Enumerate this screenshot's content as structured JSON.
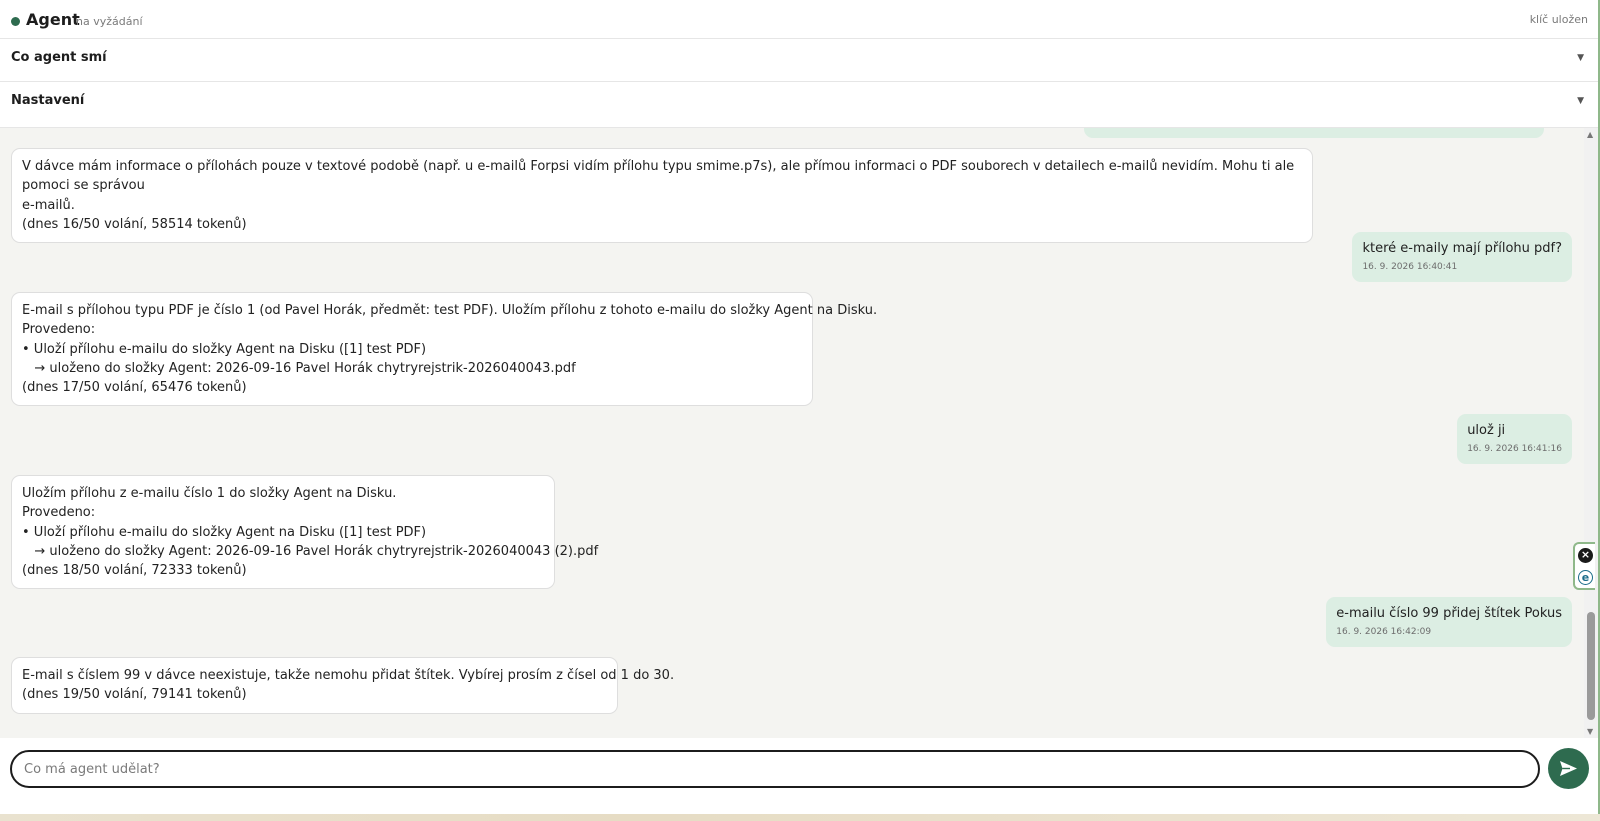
{
  "header": {
    "title": "Agent",
    "mode": "na vyžádání",
    "key_status": "klíč uložen"
  },
  "sections": [
    {
      "label": "Co agent smí"
    },
    {
      "label": "Nastavení"
    }
  ],
  "messages": [
    {
      "role": "agent",
      "lines": [
        "V dávce mám informace o přílohách pouze v textové podobě (např. u e-mailů Forpsi vidím přílohu typu smime.p7s), ale přímou informaci o PDF souborech v detailech e-mailů nevidím. Mohu ti ale pomoci se správou",
        "e-mailů.",
        "(dnes 16/50 volání, 58514 tokenů)"
      ]
    },
    {
      "role": "user",
      "text": "které e-maily mají přílohu pdf?",
      "timestamp": "16. 9. 2026 16:40:41"
    },
    {
      "role": "agent",
      "lines": [
        "E-mail s přílohou typu PDF je číslo 1 (od Pavel Horák, předmět: test PDF). Uložím přílohu z tohoto e-mailu do složky Agent na Disku.",
        "Provedeno:",
        "• Uloží přílohu e-mailu do složky Agent na Disku ([1] test PDF)",
        "   → uloženo do složky Agent: 2026-09-16 Pavel Horák chytryrejstrik-2026040043.pdf",
        "(dnes 17/50 volání, 65476 tokenů)"
      ]
    },
    {
      "role": "user",
      "text": "ulož ji",
      "timestamp": "16. 9. 2026 16:41:16"
    },
    {
      "role": "agent",
      "lines": [
        "Uložím přílohu z e-mailu číslo 1 do složky Agent na Disku.",
        "Provedeno:",
        "• Uloží přílohu e-mailu do složky Agent na Disku ([1] test PDF)",
        "   → uloženo do složky Agent: 2026-09-16 Pavel Horák chytryrejstrik-2026040043 (2).pdf",
        "(dnes 18/50 volání, 72333 tokenů)"
      ]
    },
    {
      "role": "user",
      "text": "e-mailu číslo 99 přidej štítek Pokus",
      "timestamp": "16. 9. 2026 16:42:09"
    },
    {
      "role": "agent",
      "lines": [
        "E-mail s číslem 99 v dávce neexistuje, takže nemohu přidat štítek. Vybírej prosím z čísel od 1 do 30.",
        "(dnes 19/50 volání, 79141 tokenů)"
      ]
    }
  ],
  "composer": {
    "placeholder": "Co má agent udělat?",
    "value": ""
  },
  "icons": {
    "send": "send-icon",
    "close": "close-icon",
    "extension": "e-icon",
    "chevron": "chevron-down-icon"
  },
  "colors": {
    "accent": "#2e6b4f",
    "user_bubble": "#dceee3",
    "chat_background": "#f4f4f1"
  }
}
